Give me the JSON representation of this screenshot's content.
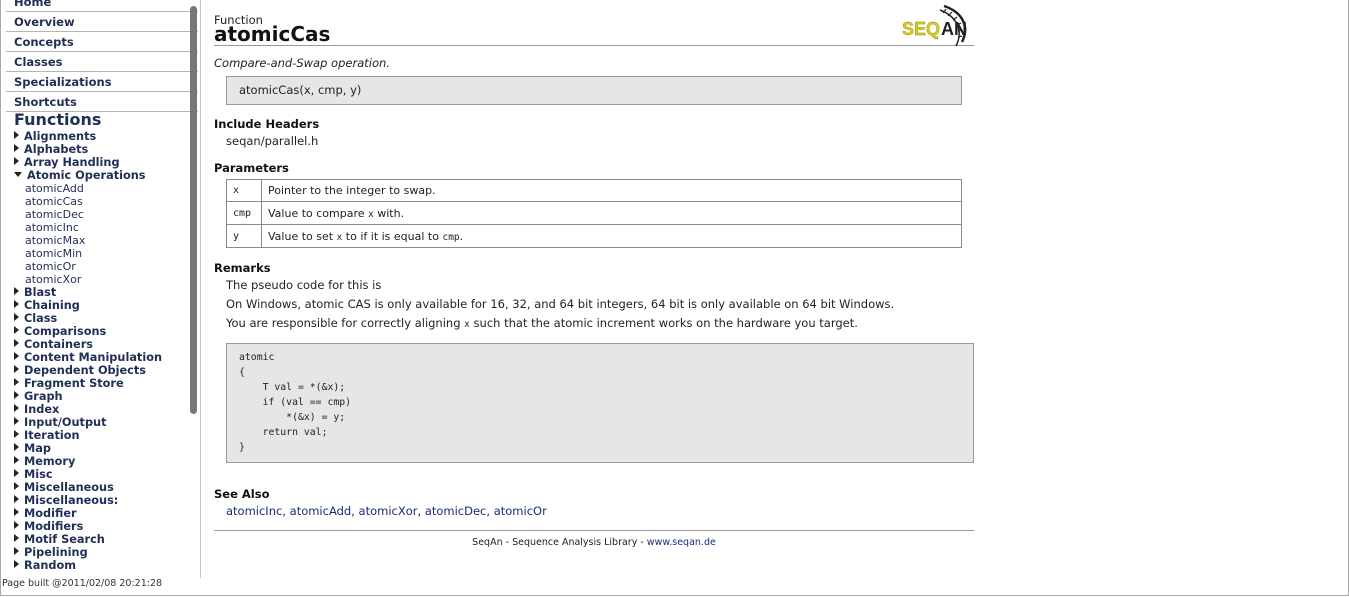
{
  "nav": {
    "links": [
      "Home",
      "Overview",
      "Concepts",
      "Classes",
      "Specializations",
      "Shortcuts"
    ]
  },
  "sidebar": {
    "heading": "Functions",
    "groups_before": [
      "Alignments",
      "Alphabets",
      "Array Handling"
    ],
    "open_group": "Atomic Operations",
    "open_items": [
      "atomicAdd",
      "atomicCas",
      "atomicDec",
      "atomicInc",
      "atomicMax",
      "atomicMin",
      "atomicOr",
      "atomicXor"
    ],
    "groups_after": [
      "Blast",
      "Chaining",
      "Class",
      "Comparisons",
      "Containers",
      "Content Manipulation",
      "Dependent Objects",
      "Fragment Store",
      "Graph",
      "Index",
      "Input/Output",
      "Iteration",
      "Map",
      "Memory",
      "Misc",
      "Miscellaneous",
      "Miscellaneous:",
      "Modifier",
      "Modifiers",
      "Motif Search",
      "Pipelining",
      "Random"
    ],
    "page_built": "Page built @2011/02/08 20:21:28"
  },
  "main": {
    "kind": "Function",
    "title": "atomicCas",
    "logo_text": "SEQAN",
    "description": "Compare-and-Swap operation.",
    "signature": "atomicCas(x, cmp, y)",
    "include_heading": "Include Headers",
    "include_file": "seqan/parallel.h",
    "params_heading": "Parameters",
    "params": [
      {
        "name": "x",
        "pre": "Pointer to the integer to swap.",
        "code": "",
        "post": ""
      },
      {
        "name": "cmp",
        "pre": "Value to compare ",
        "code": "x",
        "post": " with."
      },
      {
        "name": "y",
        "pre": "Value to set ",
        "code": "x",
        "post": " to if it is equal to ",
        "code2": "cmp",
        "post2": "."
      }
    ],
    "remarks_heading": "Remarks",
    "remark1": "The pseudo code for this is",
    "remark2": "On Windows, atomic CAS is only available for 16, 32, and 64 bit integers, 64 bit is only available on 64 bit Windows.",
    "remark3_pre": "You are responsible for correctly aligning ",
    "remark3_code": "x",
    "remark3_post": " such that the atomic increment works on the hardware you target.",
    "code": "atomic\n{\n    T val = *(&x);\n    if (val == cmp)\n        *(&x) = y;\n    return val;\n}",
    "see_also_heading": "See Also",
    "see_also": [
      "atomicInc",
      "atomicAdd",
      "atomicXor",
      "atomicDec",
      "atomicOr"
    ],
    "footer_text": "SeqAn - Sequence Analysis Library - ",
    "footer_link": "www.seqan.de"
  }
}
